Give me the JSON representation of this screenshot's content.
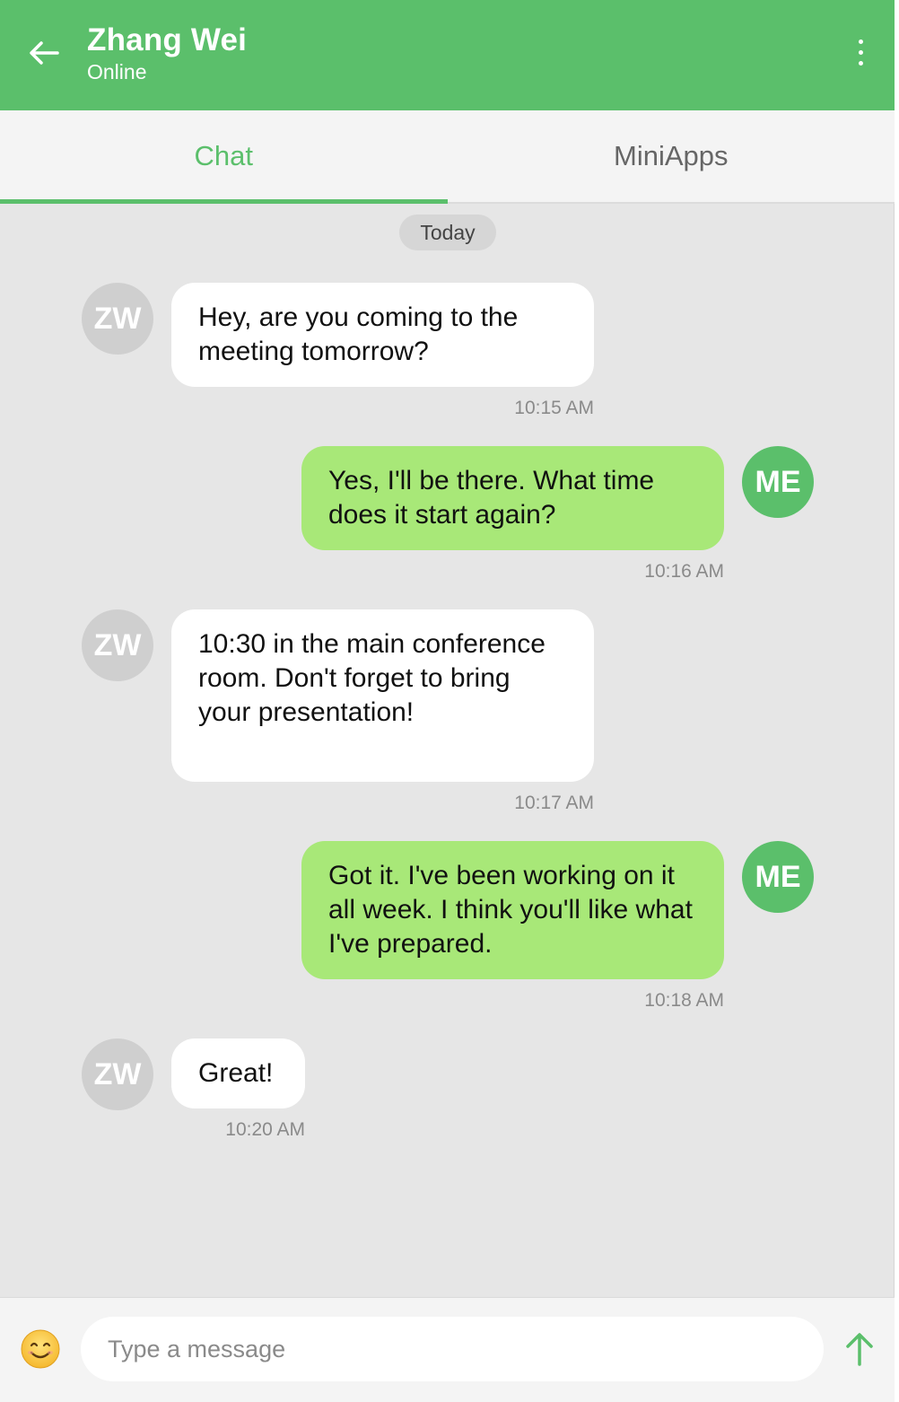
{
  "header": {
    "title": "Zhang Wei",
    "status": "Online",
    "back_icon": "arrow-left-icon",
    "more_icon": "more-vertical-icon"
  },
  "tabs": [
    {
      "label": "Chat",
      "active": true
    },
    {
      "label": "MiniApps",
      "active": false
    }
  ],
  "date_separator": "Today",
  "contact_initials": "ZW",
  "my_initials": "ME",
  "messages": [
    {
      "sender": "them",
      "text": "Hey, are you coming to the meeting tomorrow?",
      "time": "10:15 AM"
    },
    {
      "sender": "me",
      "text": "Yes, I'll be there. What time does it start again?",
      "time": "10:16 AM"
    },
    {
      "sender": "them",
      "text": "10:30 in the main conference room. Don't forget to bring your presentation!",
      "time": "10:17 AM"
    },
    {
      "sender": "me",
      "text": "Got it. I've been working on it all week. I think you'll like what I've prepared.",
      "time": "10:18 AM"
    },
    {
      "sender": "them",
      "text": "Great!",
      "time": "10:20 AM"
    }
  ],
  "composer": {
    "placeholder": "Type a message",
    "value": "",
    "emoji_icon": "smiley-face-icon",
    "send_icon": "arrow-up-send-icon"
  },
  "colors": {
    "brand_green": "#5bbf6b",
    "my_bubble": "#a8e878",
    "their_bubble": "#ffffff",
    "background": "#e6e6e6"
  }
}
